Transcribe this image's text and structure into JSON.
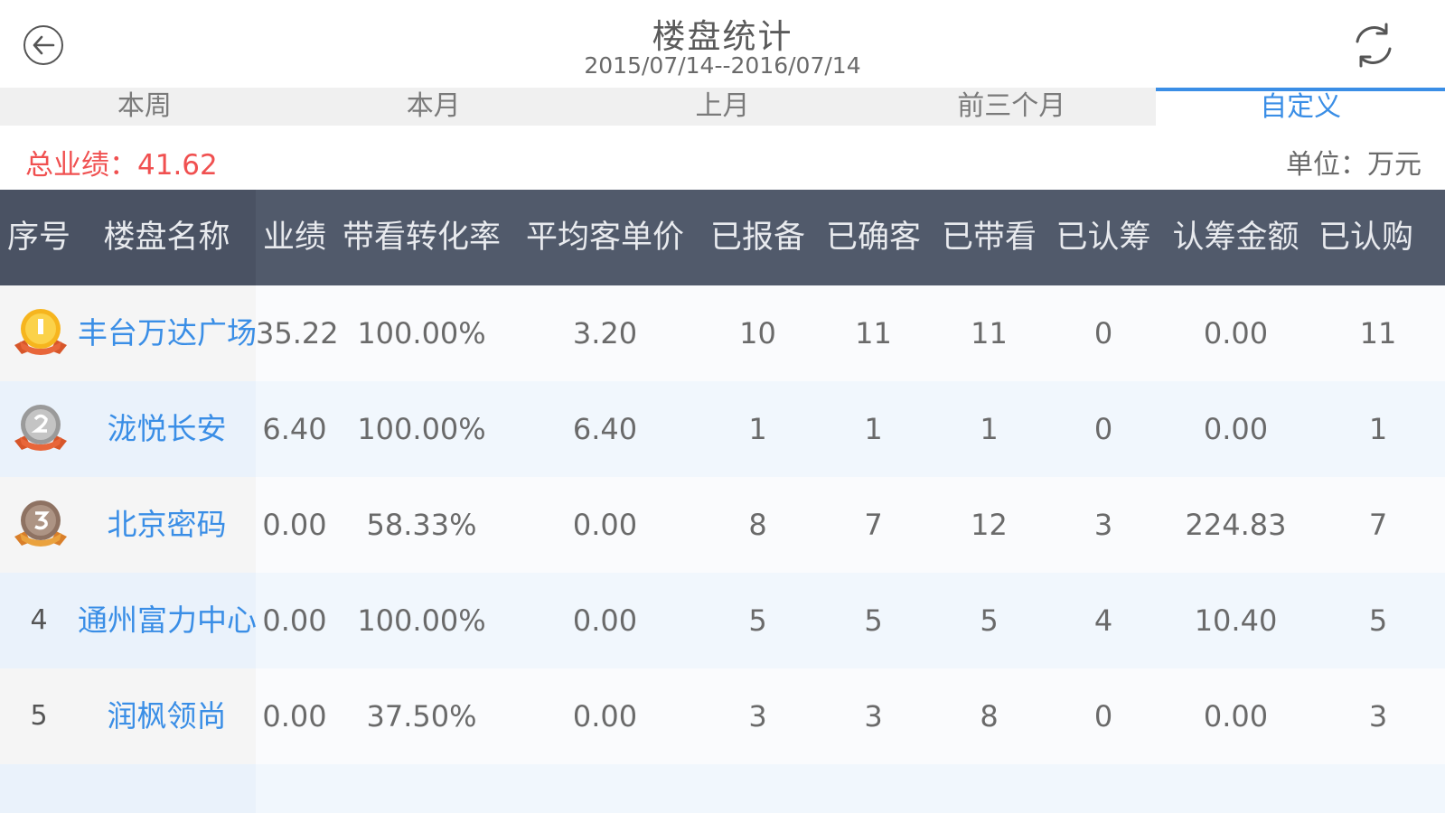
{
  "header": {
    "title": "楼盘统计",
    "date_range": "2015/07/14--2016/07/14",
    "back_icon": "back-arrow-icon",
    "refresh_icon": "refresh-icon"
  },
  "tabs": [
    {
      "label": "本周",
      "active": false
    },
    {
      "label": "本月",
      "active": false
    },
    {
      "label": "上月",
      "active": false
    },
    {
      "label": "前三个月",
      "active": false
    },
    {
      "label": "自定义",
      "active": true
    }
  ],
  "summary": {
    "total_label": "总业绩：",
    "total_value": "41.62",
    "unit_label": "单位：万元"
  },
  "colors": {
    "accent": "#3a8ee6",
    "total_red": "#f05050",
    "header_bg": "#515a6b"
  },
  "table": {
    "columns": [
      "序号",
      "楼盘名称",
      "业绩",
      "带看转化率",
      "平均客单价",
      "已报备",
      "已确客",
      "已带看",
      "已认筹",
      "认筹金额",
      "已认购"
    ],
    "rows": [
      {
        "rank": "1",
        "medal": "gold",
        "name": "丰台万达广场",
        "perf": "35.22",
        "conv": "100.00%",
        "avg": "3.20",
        "reported": "10",
        "confirmed": "11",
        "visited": "11",
        "subscribed": "0",
        "sub_amount": "0.00",
        "purchased": "11"
      },
      {
        "rank": "2",
        "medal": "silver",
        "name": "泷悦长安",
        "perf": "6.40",
        "conv": "100.00%",
        "avg": "6.40",
        "reported": "1",
        "confirmed": "1",
        "visited": "1",
        "subscribed": "0",
        "sub_amount": "0.00",
        "purchased": "1"
      },
      {
        "rank": "3",
        "medal": "bronze",
        "name": "北京密码",
        "perf": "0.00",
        "conv": "58.33%",
        "avg": "0.00",
        "reported": "8",
        "confirmed": "7",
        "visited": "12",
        "subscribed": "3",
        "sub_amount": "224.83",
        "purchased": "7"
      },
      {
        "rank": "4",
        "medal": "",
        "name": "通州富力中心",
        "perf": "0.00",
        "conv": "100.00%",
        "avg": "0.00",
        "reported": "5",
        "confirmed": "5",
        "visited": "5",
        "subscribed": "4",
        "sub_amount": "10.40",
        "purchased": "5"
      },
      {
        "rank": "5",
        "medal": "",
        "name": "润枫领尚",
        "perf": "0.00",
        "conv": "37.50%",
        "avg": "0.00",
        "reported": "3",
        "confirmed": "3",
        "visited": "8",
        "subscribed": "0",
        "sub_amount": "0.00",
        "purchased": "3"
      }
    ]
  }
}
